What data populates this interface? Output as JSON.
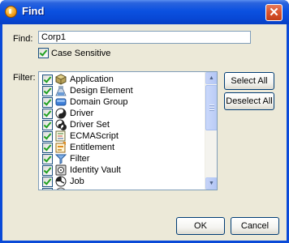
{
  "window": {
    "title": "Find",
    "close_glyph": "✕"
  },
  "find": {
    "label": "Find:",
    "value": "Corp1"
  },
  "case_sensitive": {
    "label": "Case Sensitive",
    "checked": true
  },
  "filter": {
    "label": "Filter:",
    "items": [
      {
        "label": "Application",
        "icon": "application-icon",
        "checked": true
      },
      {
        "label": "Design Element",
        "icon": "design-element-icon",
        "checked": true
      },
      {
        "label": "Domain Group",
        "icon": "domain-group-icon",
        "checked": true
      },
      {
        "label": "Driver",
        "icon": "driver-icon",
        "checked": true
      },
      {
        "label": "Driver Set",
        "icon": "driver-set-icon",
        "checked": true
      },
      {
        "label": "ECMAScript",
        "icon": "ecmascript-icon",
        "checked": true
      },
      {
        "label": "Entitlement",
        "icon": "entitlement-icon",
        "checked": true
      },
      {
        "label": "Filter",
        "icon": "filter-icon",
        "checked": true
      },
      {
        "label": "Identity Vault",
        "icon": "identity-vault-icon",
        "checked": true
      },
      {
        "label": "Job",
        "icon": "job-icon",
        "checked": true
      },
      {
        "label": "",
        "icon": "next-item-icon",
        "checked": true
      }
    ],
    "scroll_up_glyph": "▲",
    "scroll_down_glyph": "▼"
  },
  "buttons": {
    "select_all": "Select All",
    "deselect_all": "Deselect All",
    "ok": "OK",
    "cancel": "Cancel"
  },
  "colors": {
    "titlebar": "#0848d6",
    "dialog_bg": "#ece9d8",
    "check_green": "#21a121",
    "border_blue": "#7f9db9"
  }
}
